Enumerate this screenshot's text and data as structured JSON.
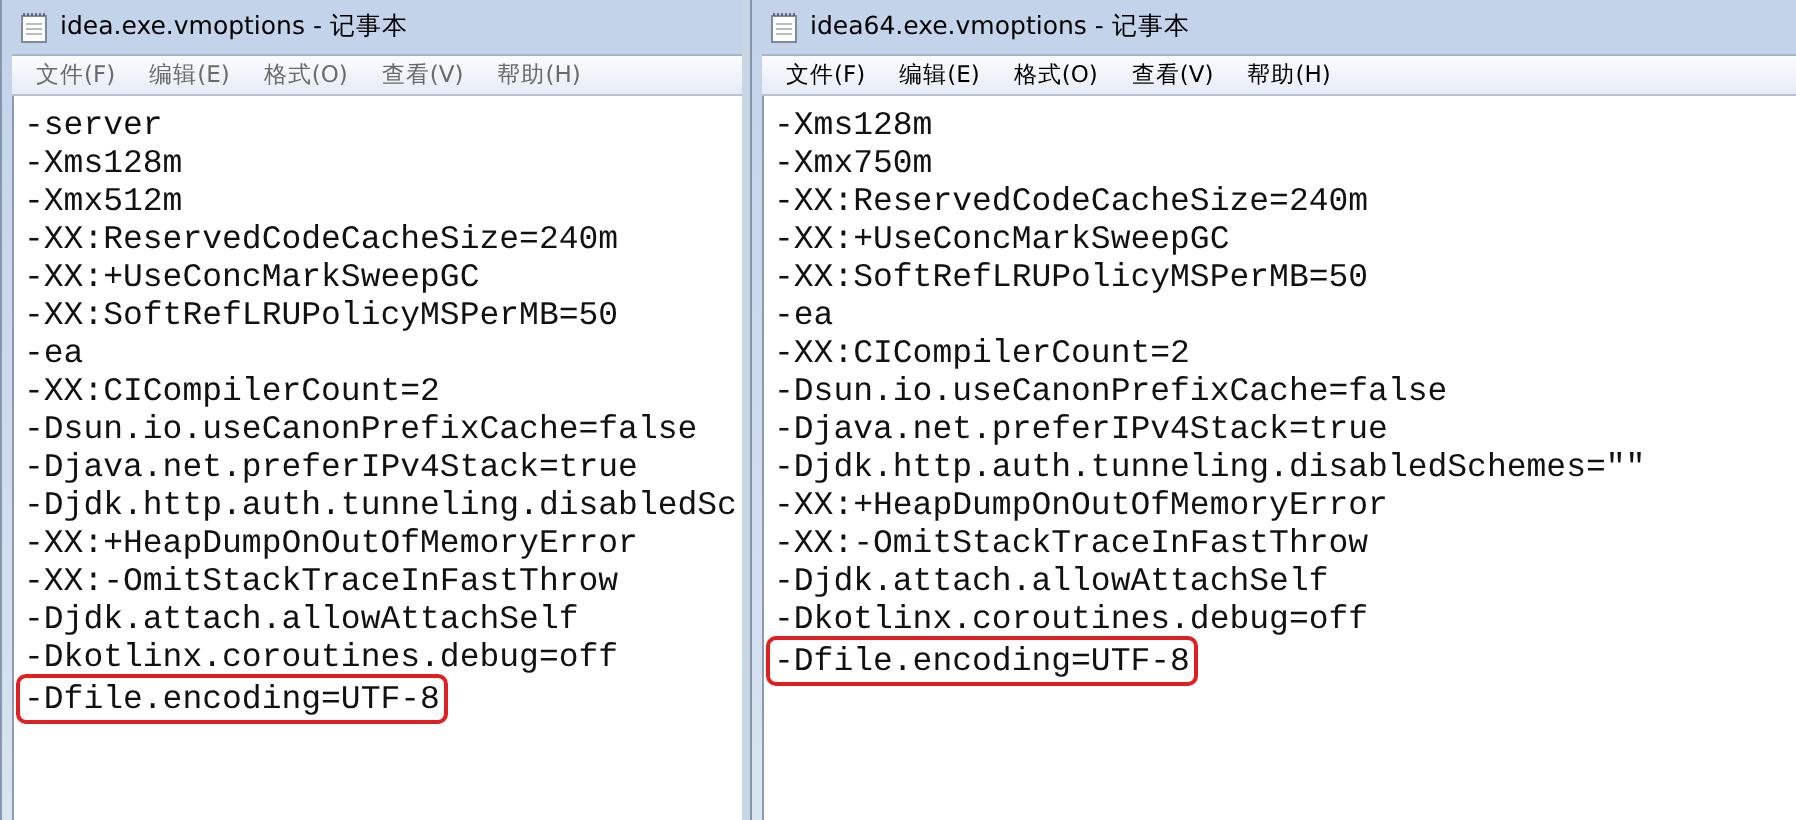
{
  "windows": [
    {
      "title": "idea.exe.vmoptions - 记事本",
      "menu": [
        "文件(F)",
        "编辑(E)",
        "格式(O)",
        "查看(V)",
        "帮助(H)"
      ],
      "lines": [
        {
          "text": "-server",
          "highlighted": false
        },
        {
          "text": "-Xms128m",
          "highlighted": false
        },
        {
          "text": "-Xmx512m",
          "highlighted": false
        },
        {
          "text": "-XX:ReservedCodeCacheSize=240m",
          "highlighted": false
        },
        {
          "text": "-XX:+UseConcMarkSweepGC",
          "highlighted": false
        },
        {
          "text": "-XX:SoftRefLRUPolicyMSPerMB=50",
          "highlighted": false
        },
        {
          "text": "-ea",
          "highlighted": false
        },
        {
          "text": "-XX:CICompilerCount=2",
          "highlighted": false
        },
        {
          "text": "-Dsun.io.useCanonPrefixCache=false",
          "highlighted": false
        },
        {
          "text": "-Djava.net.preferIPv4Stack=true",
          "highlighted": false
        },
        {
          "text": "-Djdk.http.auth.tunneling.disabledSc",
          "highlighted": false
        },
        {
          "text": "-XX:+HeapDumpOnOutOfMemoryError",
          "highlighted": false
        },
        {
          "text": "-XX:-OmitStackTraceInFastThrow",
          "highlighted": false
        },
        {
          "text": "-Djdk.attach.allowAttachSelf",
          "highlighted": false
        },
        {
          "text": "-Dkotlinx.coroutines.debug=off",
          "highlighted": false
        },
        {
          "text": "-Dfile.encoding=UTF-8",
          "highlighted": true
        }
      ]
    },
    {
      "title": "idea64.exe.vmoptions - 记事本",
      "menu": [
        "文件(F)",
        "编辑(E)",
        "格式(O)",
        "查看(V)",
        "帮助(H)"
      ],
      "lines": [
        {
          "text": "-Xms128m",
          "highlighted": false
        },
        {
          "text": "-Xmx750m",
          "highlighted": false
        },
        {
          "text": "-XX:ReservedCodeCacheSize=240m",
          "highlighted": false
        },
        {
          "text": "-XX:+UseConcMarkSweepGC",
          "highlighted": false
        },
        {
          "text": "-XX:SoftRefLRUPolicyMSPerMB=50",
          "highlighted": false
        },
        {
          "text": "-ea",
          "highlighted": false
        },
        {
          "text": "-XX:CICompilerCount=2",
          "highlighted": false
        },
        {
          "text": "-Dsun.io.useCanonPrefixCache=false",
          "highlighted": false
        },
        {
          "text": "-Djava.net.preferIPv4Stack=true",
          "highlighted": false
        },
        {
          "text": "-Djdk.http.auth.tunneling.disabledSchemes=\"\"",
          "highlighted": false
        },
        {
          "text": "-XX:+HeapDumpOnOutOfMemoryError",
          "highlighted": false
        },
        {
          "text": "-XX:-OmitStackTraceInFastThrow",
          "highlighted": false
        },
        {
          "text": "-Djdk.attach.allowAttachSelf",
          "highlighted": false
        },
        {
          "text": "-Dkotlinx.coroutines.debug=off",
          "highlighted": false
        },
        {
          "text": "-Dfile.encoding=UTF-8",
          "highlighted": true
        }
      ]
    }
  ]
}
